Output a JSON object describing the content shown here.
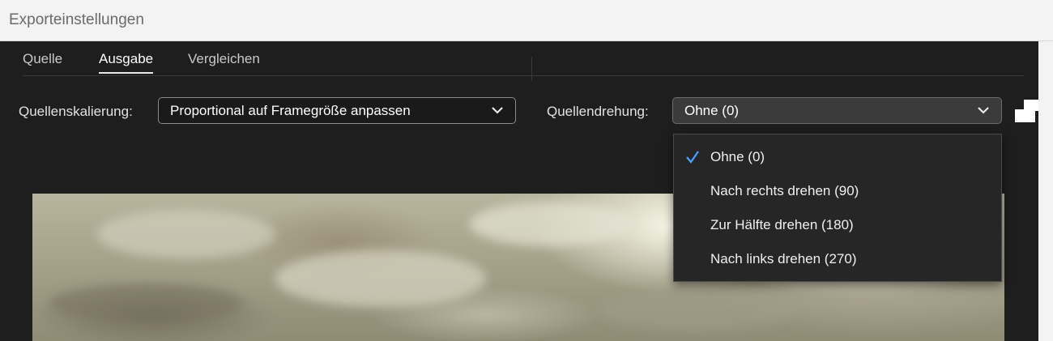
{
  "window": {
    "title": "Exporteinstellungen"
  },
  "tabs": [
    {
      "label": "Quelle",
      "active": false
    },
    {
      "label": "Ausgabe",
      "active": true
    },
    {
      "label": "Vergleichen",
      "active": false
    }
  ],
  "scaling": {
    "label": "Quellenskalierung:",
    "value": "Proportional auf Framegröße anpassen"
  },
  "rotation": {
    "label": "Quellendrehung:",
    "value": "Ohne (0)",
    "options": [
      {
        "label": "Ohne (0)",
        "selected": true
      },
      {
        "label": "Nach rechts drehen (90)",
        "selected": false
      },
      {
        "label": "Zur Hälfte drehen (180)",
        "selected": false
      },
      {
        "label": "Nach links drehen (270)",
        "selected": false
      }
    ]
  },
  "colors": {
    "accent": "#4aa3ff",
    "panel_bg": "#1e1e1e",
    "titlebar_bg": "#f3f3f3"
  },
  "icons": {
    "chevron": "chevron-down-icon",
    "check": "checkmark-icon",
    "corner": "crop-corner-icon"
  }
}
